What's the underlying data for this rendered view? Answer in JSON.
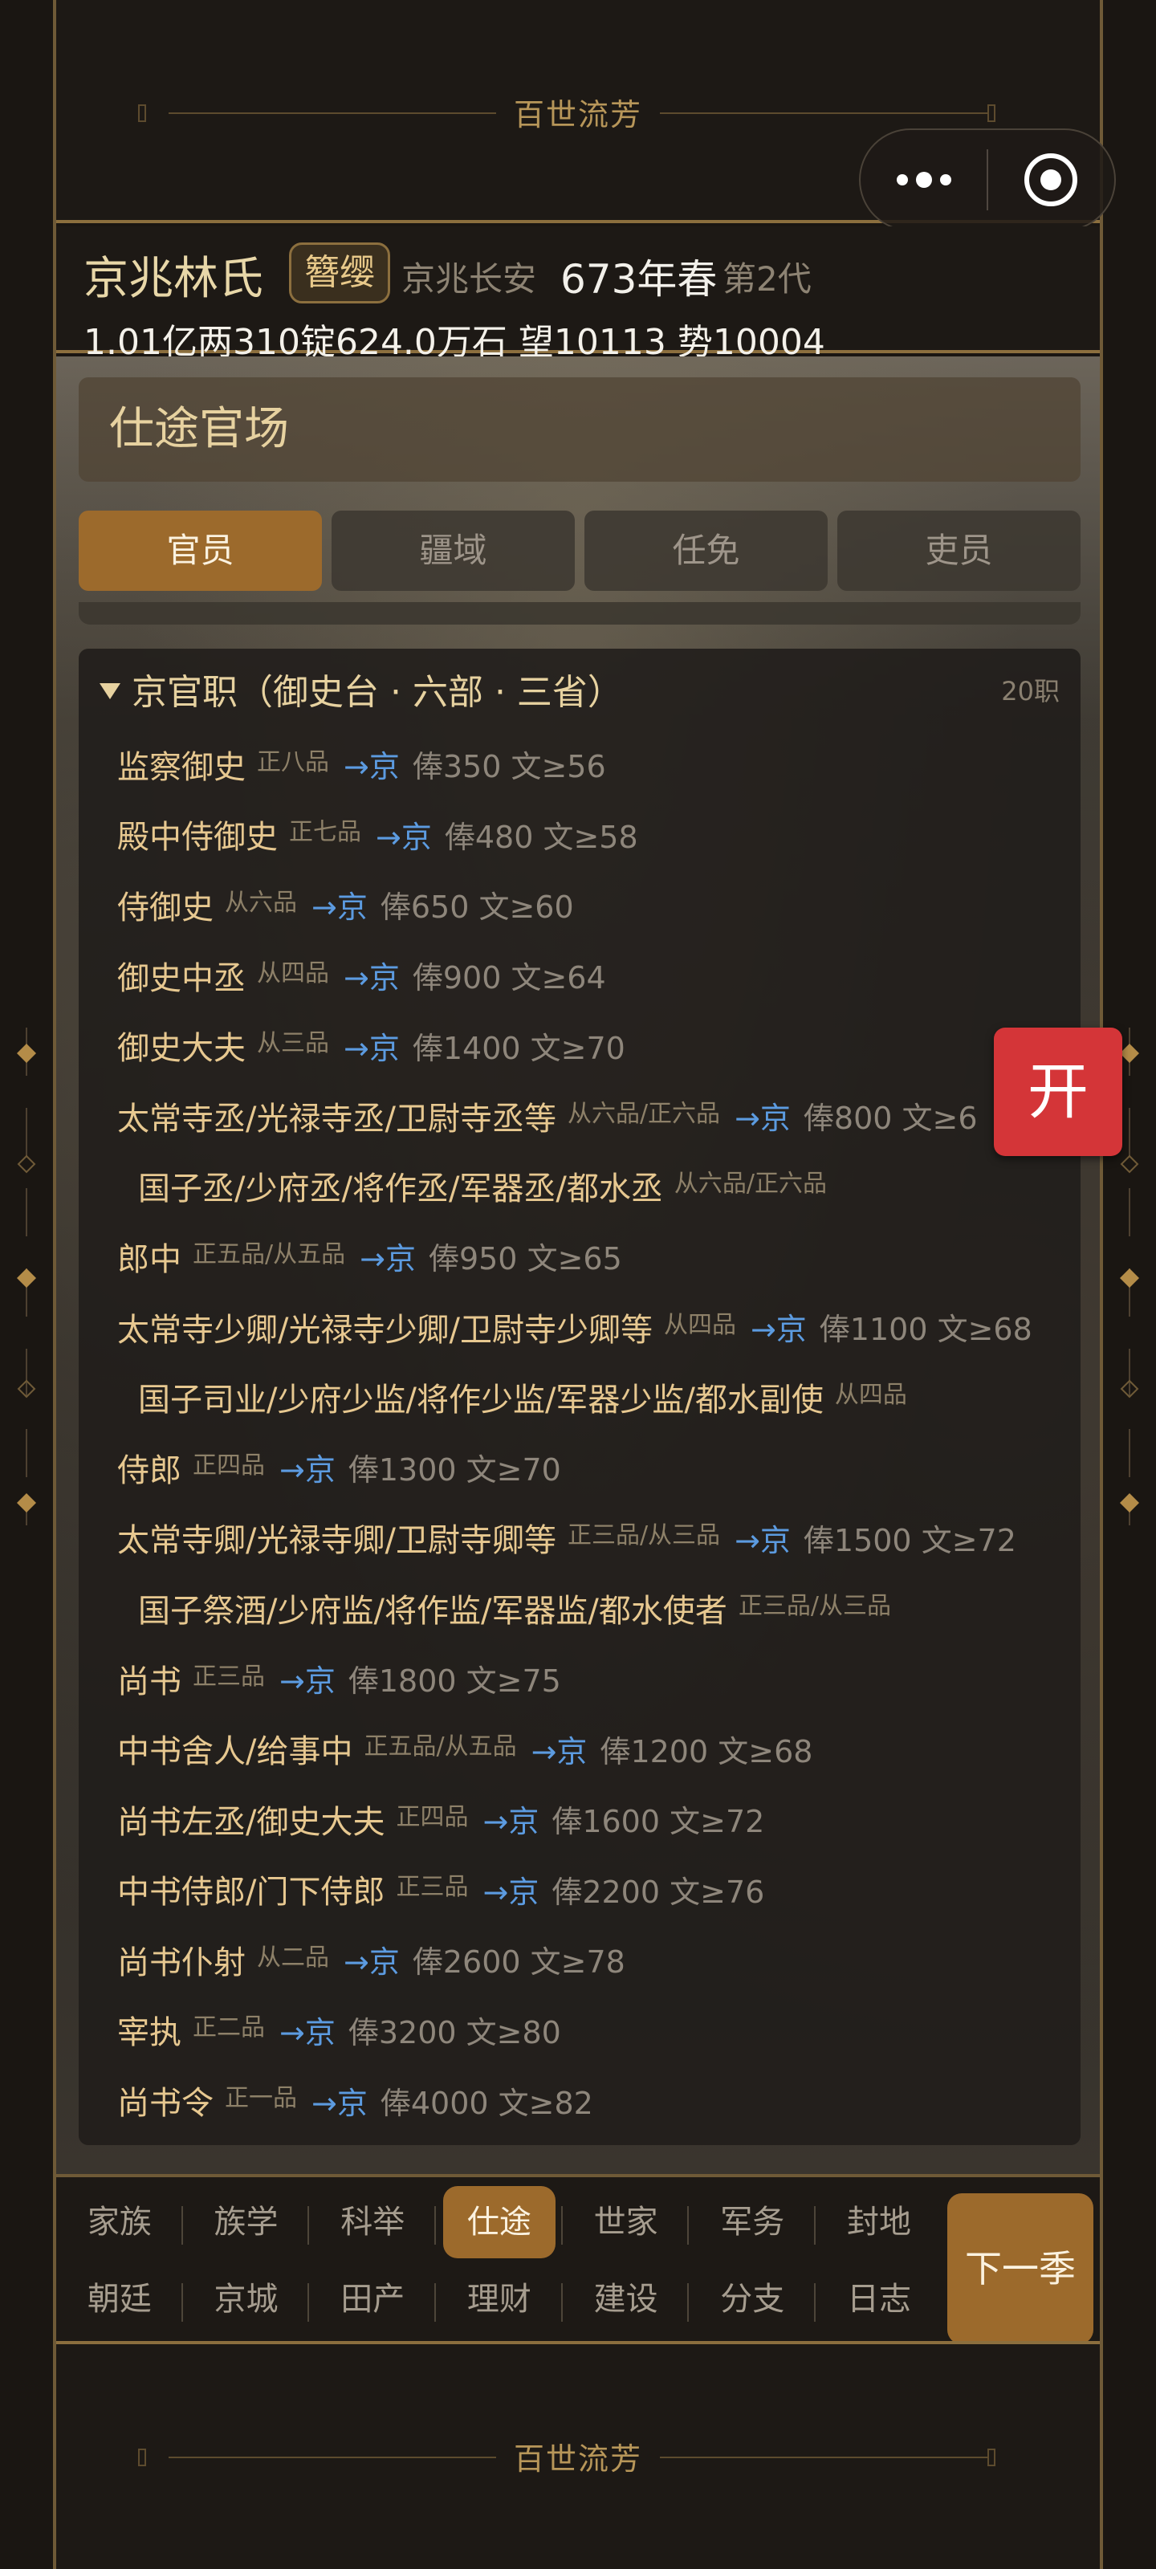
{
  "banner": {
    "title": "百世流芳"
  },
  "capsule": {
    "more_icon": "more-dots-icon",
    "close_icon": "target-circle-icon"
  },
  "header": {
    "clan_name": "京兆林氏",
    "badge": "簪缨",
    "place": "京兆长安",
    "year": "673年春",
    "generation": "第2代",
    "stats": "1.01亿两310锭624.0万石  望10113 势10004"
  },
  "page": {
    "title": "仕途官场"
  },
  "tabs": [
    {
      "label": "官员",
      "active": true
    },
    {
      "label": "疆域",
      "active": false
    },
    {
      "label": "任免",
      "active": false
    },
    {
      "label": "吏员",
      "active": false
    }
  ],
  "section": {
    "title": "京官职（御史台 · 六部 · 三省）",
    "count": "20职"
  },
  "rows": [
    {
      "title": "监察御史",
      "rank": "正八品",
      "arrow": "→京",
      "pay": "俸350 文≥56",
      "sub": false
    },
    {
      "title": "殿中侍御史",
      "rank": "正七品",
      "arrow": "→京",
      "pay": "俸480 文≥58",
      "sub": false
    },
    {
      "title": "侍御史",
      "rank": "从六品",
      "arrow": "→京",
      "pay": "俸650 文≥60",
      "sub": false
    },
    {
      "title": "御史中丞",
      "rank": "从四品",
      "arrow": "→京",
      "pay": "俸900 文≥64",
      "sub": false
    },
    {
      "title": "御史大夫",
      "rank": "从三品",
      "arrow": "→京",
      "pay": "俸1400 文≥70",
      "sub": false
    },
    {
      "title": "太常寺丞/光禄寺丞/卫尉寺丞等",
      "rank": "从六品/正六品",
      "arrow": "→京",
      "pay": "俸800 文≥6",
      "sub": false
    },
    {
      "title": "国子丞/少府丞/将作丞/军器丞/都水丞",
      "rank": "从六品/正六品",
      "arrow": "",
      "pay": "",
      "sub": true
    },
    {
      "title": "郎中",
      "rank": "正五品/从五品",
      "arrow": "→京",
      "pay": "俸950 文≥65",
      "sub": false
    },
    {
      "title": "太常寺少卿/光禄寺少卿/卫尉寺少卿等",
      "rank": "从四品",
      "arrow": "→京",
      "pay": "俸1100 文≥68",
      "sub": false
    },
    {
      "title": "国子司业/少府少监/将作少监/军器少监/都水副使",
      "rank": "从四品",
      "arrow": "",
      "pay": "",
      "sub": true
    },
    {
      "title": "侍郎",
      "rank": "正四品",
      "arrow": "→京",
      "pay": "俸1300 文≥70",
      "sub": false
    },
    {
      "title": "太常寺卿/光禄寺卿/卫尉寺卿等",
      "rank": "正三品/从三品",
      "arrow": "→京",
      "pay": "俸1500 文≥72",
      "sub": false
    },
    {
      "title": "国子祭酒/少府监/将作监/军器监/都水使者",
      "rank": "正三品/从三品",
      "arrow": "",
      "pay": "",
      "sub": true
    },
    {
      "title": "尚书",
      "rank": "正三品",
      "arrow": "→京",
      "pay": "俸1800 文≥75",
      "sub": false
    },
    {
      "title": "中书舍人/给事中",
      "rank": "正五品/从五品",
      "arrow": "→京",
      "pay": "俸1200 文≥68",
      "sub": false
    },
    {
      "title": "尚书左丞/御史大夫",
      "rank": "正四品",
      "arrow": "→京",
      "pay": "俸1600 文≥72",
      "sub": false
    },
    {
      "title": "中书侍郎/门下侍郎",
      "rank": "正三品",
      "arrow": "→京",
      "pay": "俸2200 文≥76",
      "sub": false
    },
    {
      "title": "尚书仆射",
      "rank": "从二品",
      "arrow": "→京",
      "pay": "俸2600 文≥78",
      "sub": false
    },
    {
      "title": "宰执",
      "rank": "正二品",
      "arrow": "→京",
      "pay": "俸3200 文≥80",
      "sub": false
    },
    {
      "title": "尚书令",
      "rank": "正一品",
      "arrow": "→京",
      "pay": "俸4000 文≥82",
      "sub": false
    }
  ],
  "open_button": {
    "label": "开"
  },
  "nav": {
    "row1": [
      {
        "label": "家族",
        "active": false
      },
      {
        "label": "族学",
        "active": false
      },
      {
        "label": "科举",
        "active": false
      },
      {
        "label": "仕途",
        "active": true
      },
      {
        "label": "世家",
        "active": false
      },
      {
        "label": "军务",
        "active": false
      },
      {
        "label": "封地",
        "active": false
      }
    ],
    "row2": [
      {
        "label": "朝廷",
        "active": false
      },
      {
        "label": "京城",
        "active": false
      },
      {
        "label": "田产",
        "active": false
      },
      {
        "label": "理财",
        "active": false
      },
      {
        "label": "建设",
        "active": false
      },
      {
        "label": "分支",
        "active": false
      },
      {
        "label": "日志",
        "active": false
      }
    ],
    "next_label": "下一季"
  },
  "colors": {
    "accent": "#9c6a2c",
    "gold_text": "#e7c890",
    "blue_arrow": "#5c9be0",
    "open_red": "#d43538"
  }
}
